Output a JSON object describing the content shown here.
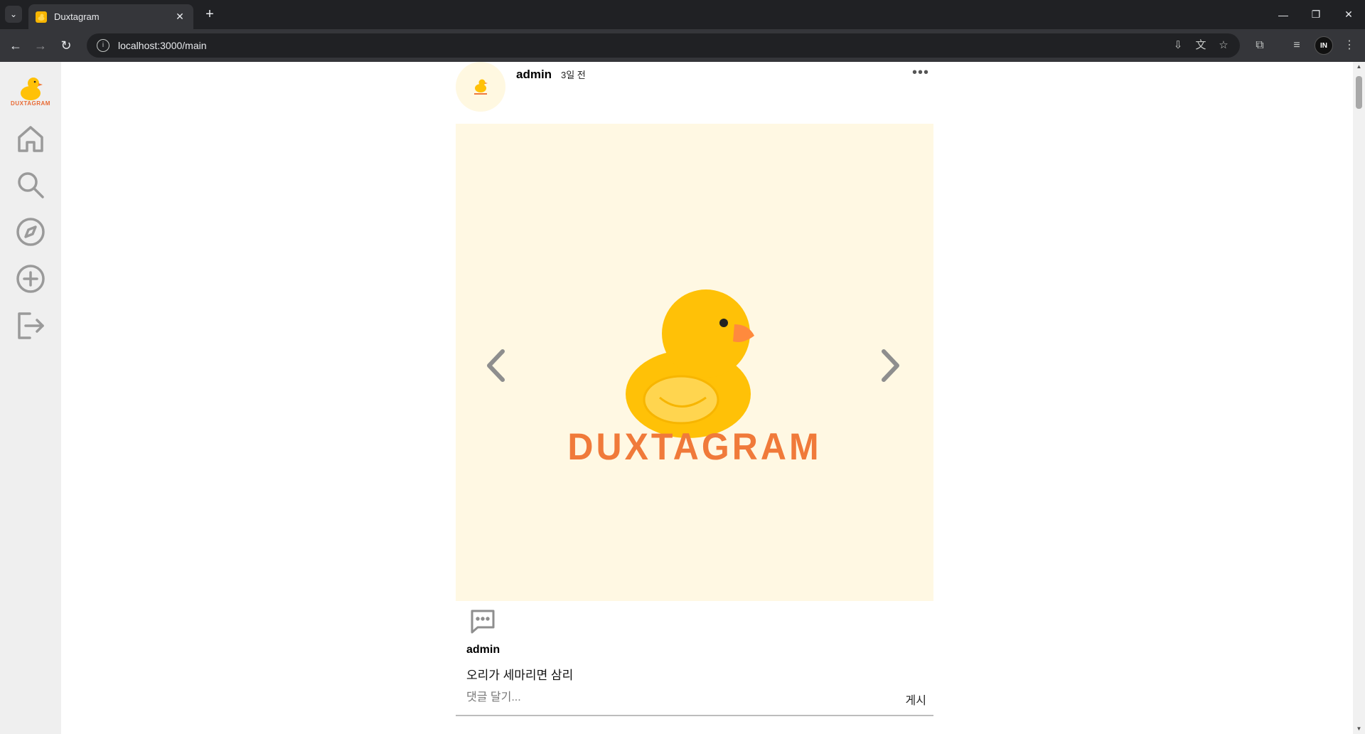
{
  "browser": {
    "tab_title": "Duxtagram",
    "url": "localhost:3000/main",
    "new_tab": "+",
    "profile_initials": "IN"
  },
  "sidebar": {
    "logo_text": "DUXTAGRAM",
    "items": [
      {
        "name": "home",
        "icon": "home-icon"
      },
      {
        "name": "search",
        "icon": "search-icon"
      },
      {
        "name": "explore",
        "icon": "compass-icon"
      },
      {
        "name": "create",
        "icon": "plus-circle-icon"
      },
      {
        "name": "logout",
        "icon": "logout-icon"
      }
    ]
  },
  "post": {
    "username": "admin",
    "time": "3일 전",
    "more": "•••",
    "image_brand_text": "DUXTAGRAM",
    "caption_user": "admin",
    "caption": "오리가 세마리면 삼리",
    "comment_placeholder": "댓글 달기...",
    "post_button": "게시"
  },
  "colors": {
    "sidebar_bg": "#efefef",
    "image_bg": "#fff8e3",
    "duck_yellow": "#ffc107",
    "brand_orange": "#f07a3a"
  }
}
